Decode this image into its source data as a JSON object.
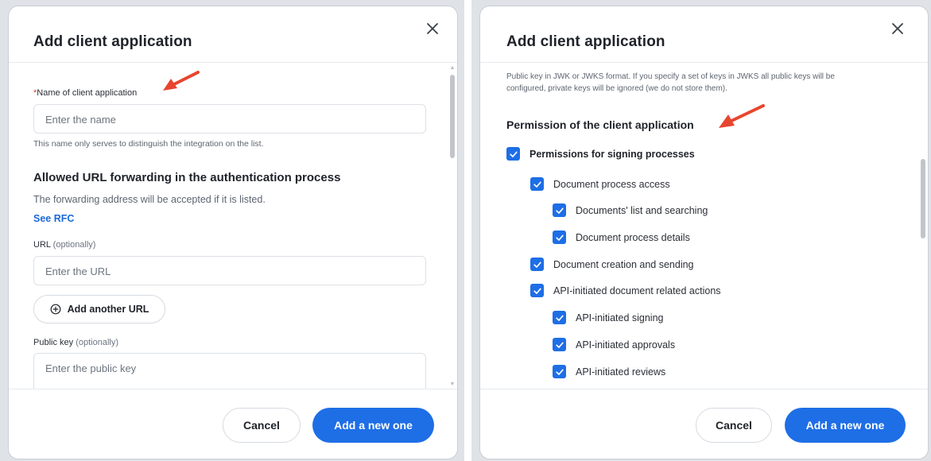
{
  "left_dialog": {
    "title": "Add client application",
    "name_field": {
      "required_mark": "*",
      "label": "Name of client application",
      "placeholder": "Enter the name",
      "hint": "This name only serves to distinguish the integration on the list."
    },
    "url_section": {
      "title": "Allowed URL forwarding in the authentication process",
      "description": "The forwarding address will be accepted if it is listed.",
      "link": "See RFC",
      "url_label": "URL",
      "url_optional": "(optionally)",
      "url_placeholder": "Enter the URL",
      "add_url_button": "Add another URL"
    },
    "public_key": {
      "label": "Public key",
      "optional": "(optionally)",
      "placeholder": "Enter the public key"
    },
    "footer": {
      "cancel": "Cancel",
      "submit": "Add a new one"
    }
  },
  "right_dialog": {
    "title": "Add client application",
    "public_key_hint_line1": "Public key in JWK or JWKS format. If you specify a set of keys in JWKS all public keys will be",
    "public_key_hint_line2": "configured, private keys will be ignored (we do not store them).",
    "permissions_title": "Permission of the client application",
    "permissions": [
      {
        "label": "Permissions for signing processes",
        "level": 0,
        "checked": true,
        "bold": true
      },
      {
        "label": "Document process access",
        "level": 1,
        "checked": true
      },
      {
        "label": "Documents' list and searching",
        "level": 2,
        "checked": true
      },
      {
        "label": "Document process details",
        "level": 2,
        "checked": true
      },
      {
        "label": "Document creation and sending",
        "level": 1,
        "checked": true
      },
      {
        "label": "API-initiated document related actions",
        "level": 1,
        "checked": true
      },
      {
        "label": "API-initiated signing",
        "level": 2,
        "checked": true
      },
      {
        "label": "API-initiated approvals",
        "level": 2,
        "checked": true
      },
      {
        "label": "API-initiated reviews",
        "level": 2,
        "checked": true
      }
    ],
    "footer": {
      "cancel": "Cancel",
      "submit": "Add a new one"
    }
  },
  "colors": {
    "primary": "#1e6ee6",
    "link": "#1a6ad8",
    "required": "#e0432f",
    "annotation_arrow": "#e8452f"
  },
  "icons": [
    "close-icon",
    "plus-circle-icon",
    "checkmark-icon",
    "annotation-arrow-icon"
  ]
}
